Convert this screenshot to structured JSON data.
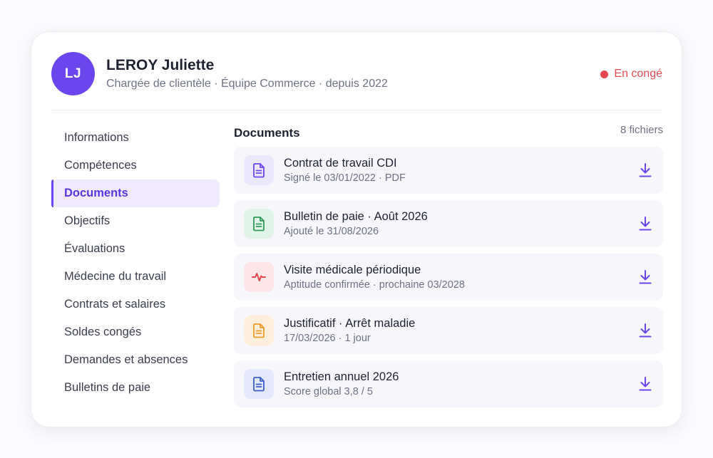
{
  "employee": {
    "initials": "LJ",
    "name": "LEROY Juliette",
    "subtitle": "Chargée de clientèle · Équipe Commerce · depuis 2022",
    "status": "En congé",
    "status_color": "#e2474f"
  },
  "sidebar": {
    "items": [
      {
        "label": "Informations",
        "active": false
      },
      {
        "label": "Compétences",
        "active": false
      },
      {
        "label": "Documents",
        "active": true
      },
      {
        "label": "Objectifs",
        "active": false
      },
      {
        "label": "Évaluations",
        "active": false
      },
      {
        "label": "Médecine du travail",
        "active": false
      },
      {
        "label": "Contrats et salaires",
        "active": false
      },
      {
        "label": "Soldes congés",
        "active": false
      },
      {
        "label": "Demandes et absences",
        "active": false
      },
      {
        "label": "Bulletins de paie",
        "active": false
      }
    ]
  },
  "documents": {
    "title": "Documents",
    "count": "8 fichiers",
    "items": [
      {
        "title": "Contrat de travail CDI",
        "meta": "Signé le 03/01/2022 · PDF",
        "icon": "document-icon",
        "color": "#6b46ec",
        "bg": "#ece8fc"
      },
      {
        "title": "Bulletin de paie · Août 2026",
        "meta": "Ajouté le 31/08/2026",
        "icon": "document-icon",
        "color": "#2f9a55",
        "bg": "#e2f4e8"
      },
      {
        "title": "Visite médicale périodique",
        "meta": "Aptitude confirmée · prochaine 03/2028",
        "icon": "heartbeat-icon",
        "color": "#e0434c",
        "bg": "#fce6e7"
      },
      {
        "title": "Justificatif · Arrêt maladie",
        "meta": "17/03/2026 · 1 jour",
        "icon": "document-icon",
        "color": "#ef9a2a",
        "bg": "#fdefdc"
      },
      {
        "title": "Entretien annuel 2026",
        "meta": "Score global 3,8 / 5",
        "icon": "document-icon",
        "color": "#3d5ec8",
        "bg": "#e3e9fb"
      }
    ]
  },
  "colors": {
    "accent": "#6b46ec",
    "download": "#6b46ec"
  }
}
